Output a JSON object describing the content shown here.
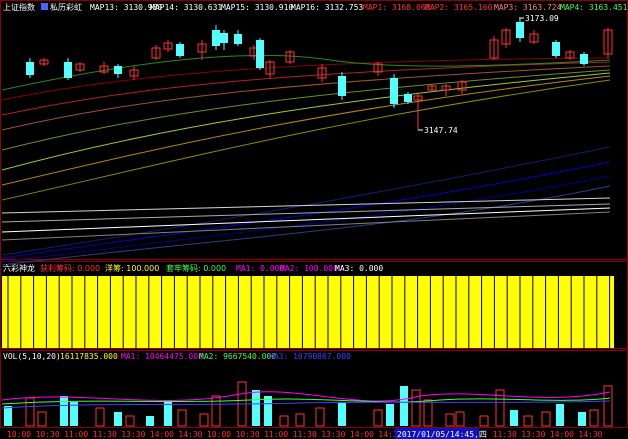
{
  "main_panel": {
    "index_name": "上证指数",
    "indicator_name": "私历彩虹",
    "map_labels": [
      {
        "text": "MAP13: 3130.980",
        "color": "#ffffff"
      },
      {
        "text": "MAP14: 3130.631",
        "color": "#ffffff"
      },
      {
        "text": "MAP15: 3130.910",
        "color": "#ffffff"
      },
      {
        "text": "MAP16: 3132.753",
        "color": "#ffffff"
      },
      {
        "text": "MAP1: 3168.068",
        "color": "#ff3030"
      },
      {
        "text": "MAP2: 3165.160",
        "color": "#ff3030"
      },
      {
        "text": "MAP3: 3163.724",
        "color": "#ff8080"
      },
      {
        "text": "MAP4: 3163.451",
        "color": "#40ff40"
      }
    ],
    "high_label": "3173.09",
    "low_label": "3147.74",
    "colors": {
      "up": "#ff3232",
      "down": "#54ffff"
    }
  },
  "mid_panel": {
    "labels": [
      {
        "text": "六彩神龙",
        "color": "#ffffff"
      },
      {
        "text": "获利筹码: 0.000",
        "color": "#ff3030"
      },
      {
        "text": "洋筹: 100.000",
        "color": "#ffff00"
      },
      {
        "text": "套牢筹码: 0.000",
        "color": "#40ff40"
      },
      {
        "text": "MA1: 0.000",
        "color": "#ff00ff"
      },
      {
        "text": "MA2: 100.000",
        "color": "#ff00ff"
      },
      {
        "text": "MA3: 0.000",
        "color": "#ffffff"
      }
    ],
    "fill_percent": 100,
    "fill_color": "#ffff00"
  },
  "vol_panel": {
    "labels": [
      {
        "text": "VOL(5,10,20)",
        "color": "#ffffff"
      },
      {
        "text": "16117835.000",
        "color": "#ffff00"
      },
      {
        "text": "MA1: 10464475.000",
        "color": "#ff00ff"
      },
      {
        "text": "MA2: 9667540.000",
        "color": "#40ff40"
      },
      {
        "text": "MA3: 10790867.000",
        "color": "#4040ff"
      }
    ]
  },
  "time_axis": {
    "ticks": [
      "10:00",
      "10:30",
      "11:00",
      "11:30",
      "13:30",
      "14:00",
      "14:30",
      "10:00",
      "10:30",
      "11:00",
      "11:30",
      "13:30",
      "14:00",
      "14:30",
      "10:00",
      "10:30",
      "11:00",
      "11:30",
      "13:30",
      "14:00",
      "14:30"
    ],
    "cursor_label": "2017/01/05/14:45,四"
  }
}
